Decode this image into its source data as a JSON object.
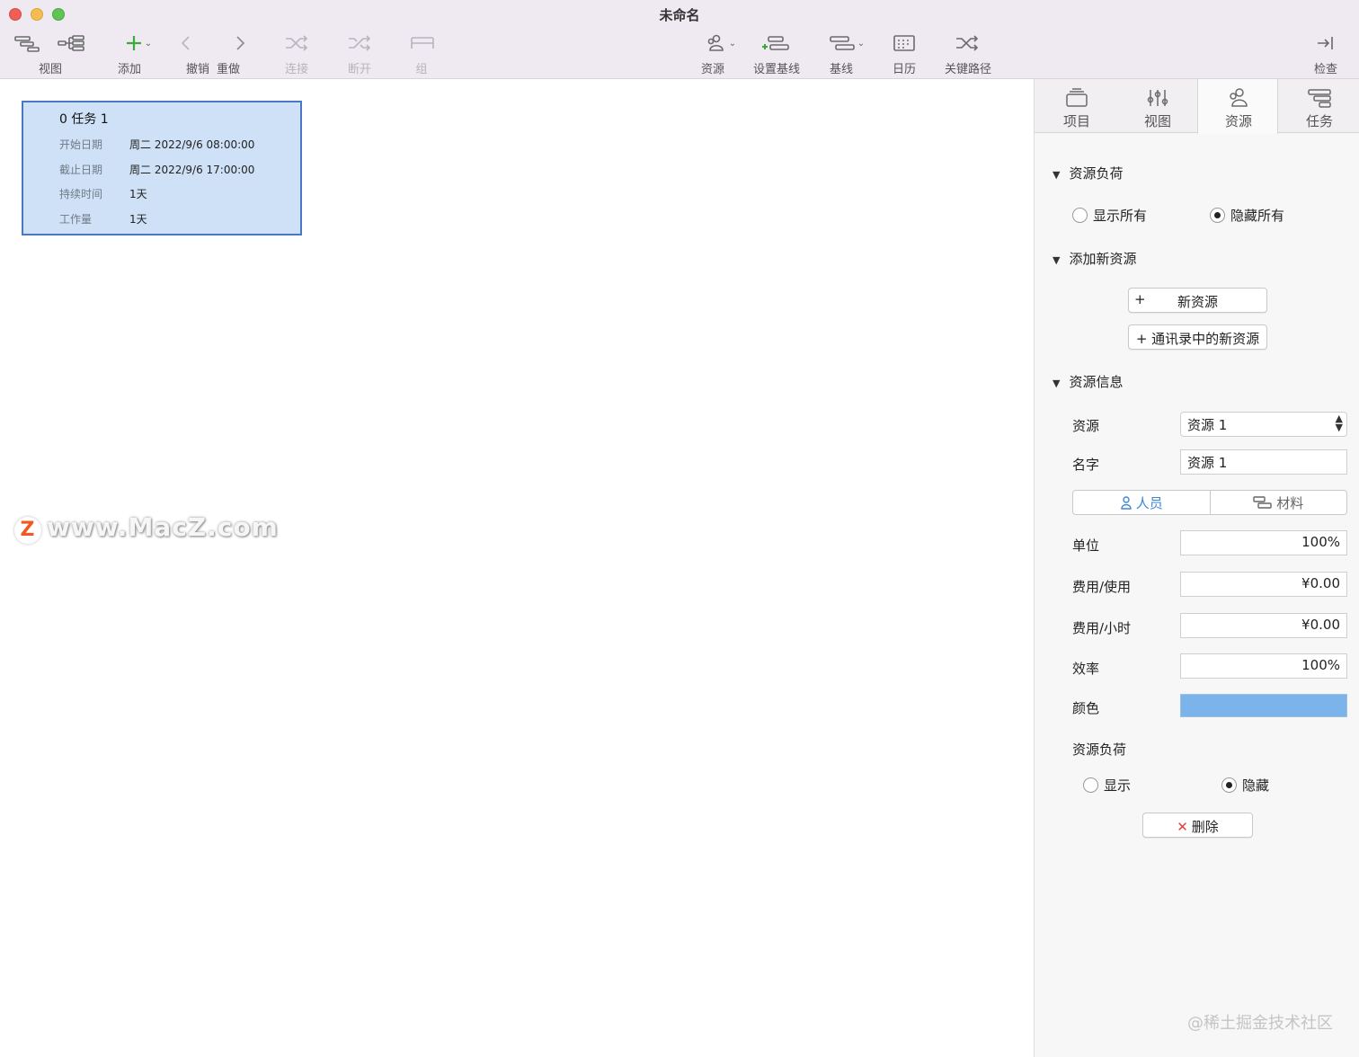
{
  "window": {
    "title": "未命名"
  },
  "toolbar": {
    "view_label": "视图",
    "add_label": "添加",
    "undo_label": "撤销",
    "redo_label": "重做",
    "connect_label": "连接",
    "disconnect_label": "断开",
    "group_label": "组",
    "resource_label": "资源",
    "set_baseline_label": "设置基线",
    "baseline_label": "基线",
    "calendar_label": "日历",
    "critical_path_label": "关键路径",
    "inspect_label": "检查"
  },
  "task_card": {
    "title": "0  任务 1",
    "rows": [
      {
        "key": "开始日期",
        "value": "周二 2022/9/6 08:00:00"
      },
      {
        "key": "截止日期",
        "value": "周二 2022/9/6 17:00:00"
      },
      {
        "key": "持续时间",
        "value": "1天"
      },
      {
        "key": "工作量",
        "value": "1天"
      }
    ]
  },
  "watermark": {
    "badge": "Z",
    "text": "www.MacZ.com"
  },
  "inspector": {
    "tabs": [
      {
        "label": "项目",
        "icon": "project-icon"
      },
      {
        "label": "视图",
        "icon": "sliders-icon"
      },
      {
        "label": "资源",
        "icon": "people-icon"
      },
      {
        "label": "任务",
        "icon": "task-icon"
      }
    ],
    "active_tab": "资源",
    "resource_load": {
      "heading": "资源负荷",
      "show_all": "显示所有",
      "hide_all": "隐藏所有",
      "selected": "隐藏所有"
    },
    "add_resource": {
      "heading": "添加新资源",
      "new_resource_plus": "+",
      "new_resource": "新资源",
      "from_contacts": "+ 通讯录中的新资源"
    },
    "resource_info": {
      "heading": "资源信息",
      "resource_label": "资源",
      "resource_value": "资源 1",
      "name_label": "名字",
      "name_value": "资源 1",
      "type_person": "人员",
      "type_material": "材料",
      "type_selected": "人员",
      "unit_label": "单位",
      "unit_value": "100%",
      "cost_use_label": "费用/使用",
      "cost_use_value": "¥0.00",
      "cost_hour_label": "费用/小时",
      "cost_hour_value": "¥0.00",
      "efficiency_label": "效率",
      "efficiency_value": "100%",
      "color_label": "颜色",
      "color_value": "#7ab4ea",
      "load_label": "资源负荷",
      "load_show": "显示",
      "load_hide": "隐藏",
      "load_selected": "隐藏",
      "delete_label": "删除"
    }
  },
  "footer_watermark": "@稀土掘金技术社区"
}
